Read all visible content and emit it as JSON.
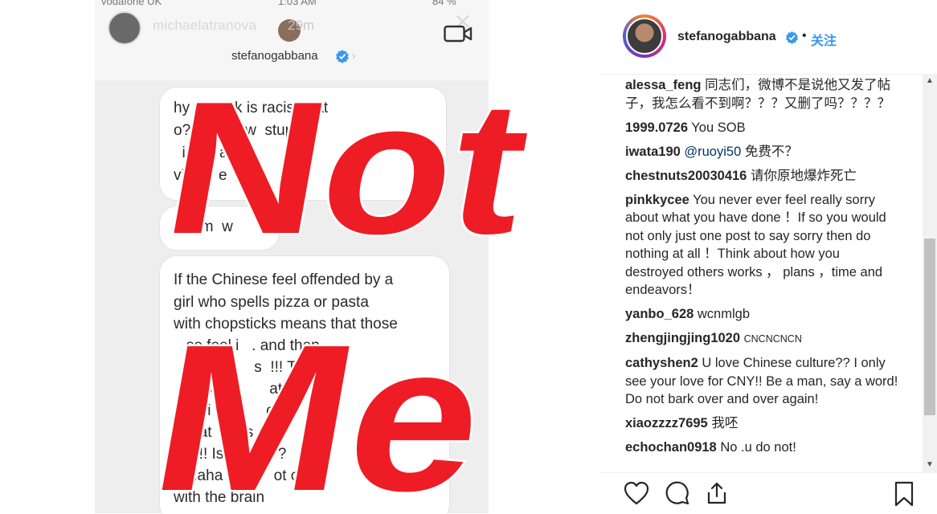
{
  "story": {
    "status_carrier": "vodafone UK",
    "status_time": "1:03 AM",
    "status_battery": "84 %",
    "story_username": "michaelatranova",
    "story_time": "29m",
    "chat_username": "stefanogabbana",
    "messages": [
      [
        "hy you ink is racist that",
        "o? Y  hink w  stupid t",
        "  in  a  a  o",
        "vid  a  e"
      ],
      [
        "Tell m  w"
      ],
      [
        "If the Chinese feel offended by a",
        "girl who spells pizza or pasta",
        "with chopsticks means that those",
        "   se feel i   . and then",
        "   roblem     s  !!! The",
        "      worl          at",
        "      hi   e        o s     nd",
        "      at   e   s   w",
        "      !! Is    raci   ?",
        "   Haha   u a    ot com",
        "with the brain"
      ]
    ],
    "overlay_line1": "Not",
    "overlay_line2": "Me",
    "overlay_color": "#ee1c24"
  },
  "post": {
    "username": "stefanogabbana",
    "separator": "•",
    "follow_label": "关注",
    "verified_color": "#3897f0",
    "comments": [
      {
        "user": "alessa_feng",
        "text": "同志们，微博不是说他又发了帖子，我怎么看不到啊？？？又删了吗？？？？"
      },
      {
        "user": "1999.0726",
        "text": "You SOB"
      },
      {
        "user": "iwata190",
        "mention": "@ruoyi50",
        "text": "免费不？"
      },
      {
        "user": "chestnuts20030416",
        "text": "请你原地爆炸死亡"
      },
      {
        "user": "pinkkycee",
        "text": "You never ever feel really sorry about what you have done ！If so you would not only just one post to say sorry then do nothing at all ！Think about how you destroyed others works ， plans ，time and endeavors！"
      },
      {
        "user": "yanbo_628",
        "text": "wcnmlgb"
      },
      {
        "user": "zhengjingjing1020",
        "text": "CNCNCNCN"
      },
      {
        "user": "cathyshen2",
        "text": "U love Chinese culture?? I only see your love for CNY!! Be a man, say a word! Do not bark over and over again!"
      },
      {
        "user": "xiaozzzz7695",
        "text": "我呸"
      },
      {
        "user": "echochan0918",
        "text": "No .u do not!"
      }
    ],
    "actions": {
      "like": "heart-icon",
      "comment": "comment-icon",
      "share": "share-icon",
      "save": "bookmark-icon"
    }
  }
}
